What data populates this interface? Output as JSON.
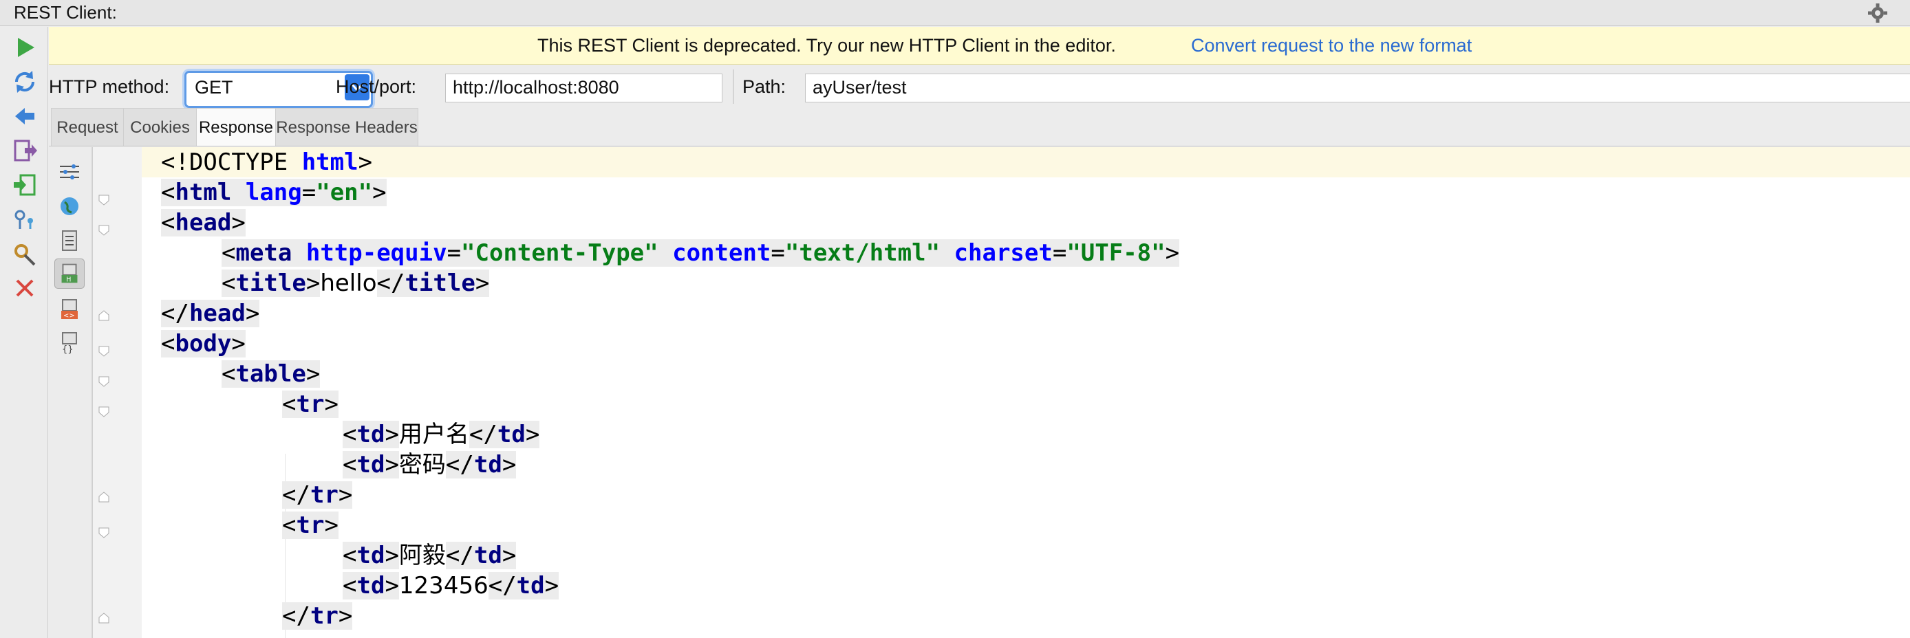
{
  "window": {
    "title": "REST Client:"
  },
  "toolbar": {
    "items": [
      "run-icon",
      "refresh-icon",
      "back-icon",
      "export-icon",
      "import-icon",
      "key-icon",
      "settings-icon",
      "close-icon"
    ]
  },
  "banner": {
    "message": "This REST Client is deprecated. Try our new HTTP Client in the editor.",
    "link": "Convert request to the new format"
  },
  "request": {
    "method_label": "HTTP method:",
    "method_value": "GET",
    "host_label": "Host/port:",
    "host_value": "http://localhost:8080",
    "path_label": "Path:",
    "path_value": "ayUser/test"
  },
  "tabs": [
    "Request",
    "Cookies",
    "Response",
    "Response Headers"
  ],
  "active_tab": "Response",
  "code_lines": [
    "<!DOCTYPE html>",
    "<html lang=\"en\">",
    "<head>",
    "    <meta http-equiv=\"Content-Type\" content=\"text/html\" charset=\"UTF-8\">",
    "    <title>hello</title>",
    "</head>",
    "<body>",
    "    <table>",
    "        <tr>",
    "            <td>用户名</td>",
    "            <td>密码</td>",
    "        </tr>",
    "        <tr>",
    "            <td>阿毅</td>",
    "            <td>123456</td>",
    "        </tr>"
  ],
  "colors": {
    "banner_bg": "#fffbd1",
    "link": "#2a6bd1",
    "tag": "#000080",
    "attribute": "#0000ff",
    "string": "#067d17"
  }
}
